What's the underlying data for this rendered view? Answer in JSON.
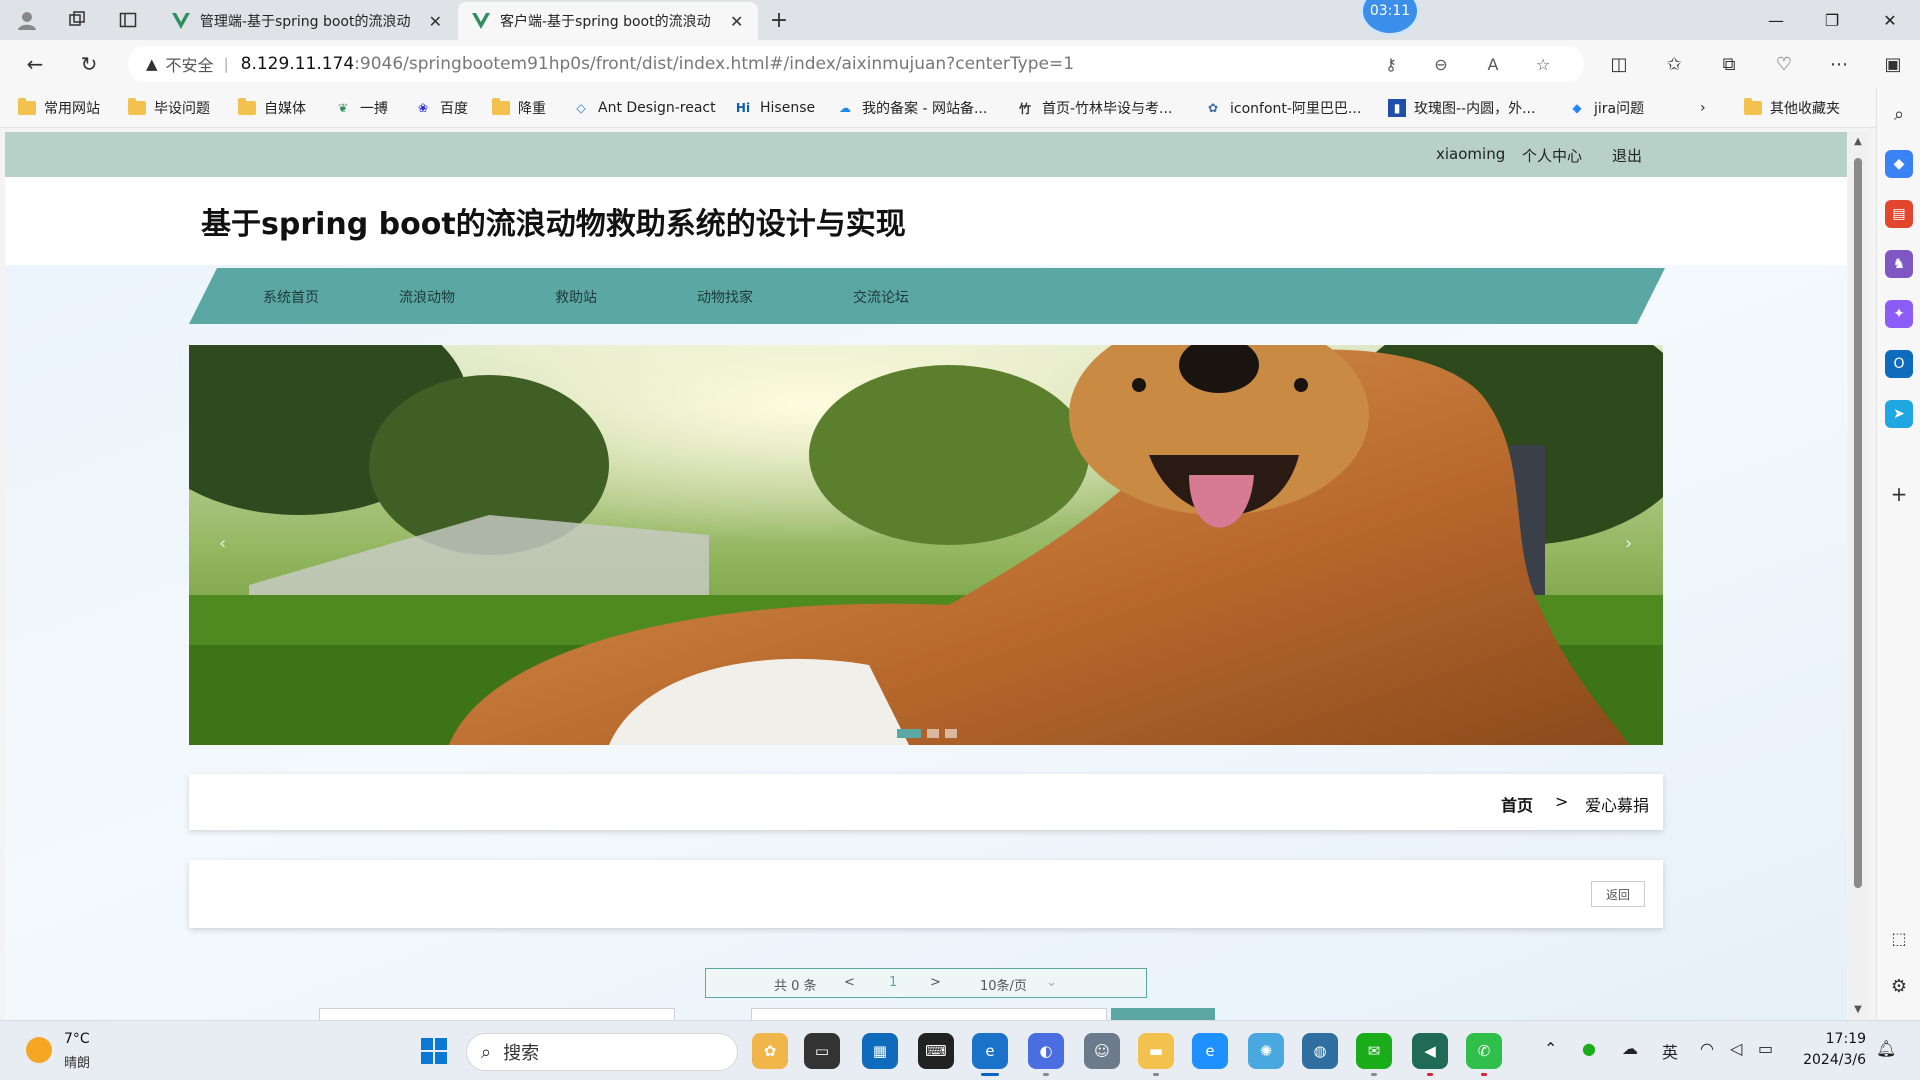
{
  "browser": {
    "tabs": [
      {
        "label": "管理端-基于spring boot的流浪动",
        "active": false
      },
      {
        "label": "客户端-基于spring boot的流浪动",
        "active": true
      }
    ],
    "timer": "03:11",
    "insecure_label": "不安全",
    "url_host": "8.129.11.174",
    "url_rest": ":9046/springbootem91hp0s/front/dist/index.html#/index/aixinmujuan?centerType=1"
  },
  "bookmarks": [
    {
      "label": "常用网站",
      "type": "folder"
    },
    {
      "label": "毕设问题",
      "type": "folder"
    },
    {
      "label": "自媒体",
      "type": "folder"
    },
    {
      "label": "一搏",
      "type": "site"
    },
    {
      "label": "百度",
      "type": "site"
    },
    {
      "label": "降重",
      "type": "folder"
    },
    {
      "label": "Ant Design-react",
      "type": "site"
    },
    {
      "label": "Hisense",
      "type": "site"
    },
    {
      "label": "我的备案 - 网站备...",
      "type": "site"
    },
    {
      "label": "首页-竹林毕设与考...",
      "type": "site"
    },
    {
      "label": "iconfont-阿里巴巴...",
      "type": "site"
    },
    {
      "label": "玫瑰图--内圆，外...",
      "type": "site"
    },
    {
      "label": "jira问题",
      "type": "site"
    },
    {
      "label": "其他收藏夹",
      "type": "folder"
    }
  ],
  "site": {
    "user": "xiaoming",
    "profile": "个人中心",
    "logout": "退出",
    "title": "基于spring boot的流浪动物救助系统的设计与实现",
    "menu": [
      "系统首页",
      "流浪动物",
      "救助站",
      "动物找家",
      "交流论坛"
    ],
    "carousel_prev": "‹",
    "carousel_next": "›",
    "carousel_active_index": 0,
    "breadcrumb": {
      "home": "首页",
      "sep": ">",
      "current": "爱心募捐"
    },
    "back_button": "返回",
    "pager": {
      "total": "共 0 条",
      "prev": "<",
      "page": "1",
      "next": ">",
      "size": "10条/页"
    }
  },
  "taskbar": {
    "weather_temp": "7°C",
    "weather_desc": "晴朗",
    "search_label": "搜索",
    "ime": "英",
    "time": "17:19",
    "date": "2024/3/6"
  },
  "colors": {
    "accent_teal": "#5ba7a3",
    "top_strip": "#b8d1c8"
  }
}
